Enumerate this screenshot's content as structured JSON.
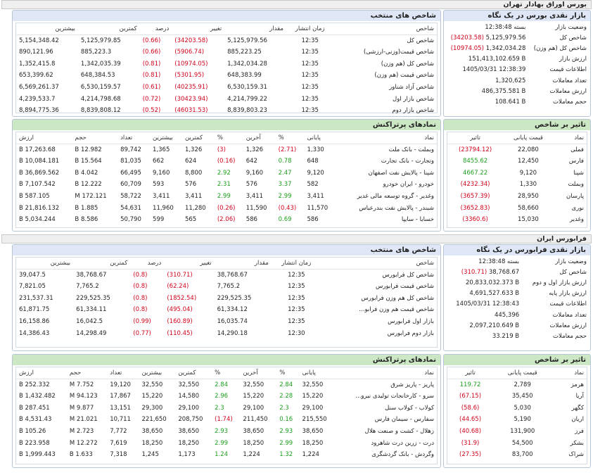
{
  "header": {
    "title": "بورس اوراق بهادار تهران"
  },
  "bourse": {
    "market_title": "بازار نقدی بورس در یک نگاه",
    "market": [
      {
        "label": "وضعیت بازار",
        "change": "",
        "value": "بسته 12:38:48"
      },
      {
        "label": "شاخص کل",
        "change": "(34203.58)",
        "value": "5,125,979.56"
      },
      {
        "label": "شاخص کل (هم وزن)",
        "change": "(10974.05)",
        "value": "1,342,034.28"
      },
      {
        "label": "ارزش بازار",
        "change": "",
        "value": "151,413,102.659 B"
      },
      {
        "label": "اطلاعات قیمت",
        "change": "",
        "value": "1405/03/31 12:38:39"
      },
      {
        "label": "تعداد معاملات",
        "change": "",
        "value": "1,320,625"
      },
      {
        "label": "ارزش معاملات",
        "change": "",
        "value": "486,375.581 B"
      },
      {
        "label": "حجم معاملات",
        "change": "",
        "value": "108.641 B"
      }
    ],
    "index_title": "شاخص های منتخب",
    "index_headers": [
      "شاخص",
      "زمان انتشار",
      "مقدار",
      "تغییر",
      "درصد",
      "کمترین",
      "بیشترین"
    ],
    "indices": [
      [
        "شاخص کل",
        "12:35",
        "5,125,979.56",
        "(34203.58)",
        "(0.66)",
        "5,125,979.85",
        "5,154,348.42"
      ],
      [
        "شاخص قیمت(وزنی-ارزشی)",
        "12:35",
        "885,223.25",
        "(5906.74)",
        "(0.66)",
        "885,223.3",
        "890,121.96"
      ],
      [
        "شاخص کل (هم وزن)",
        "12:35",
        "1,342,034.28",
        "(10974.05)",
        "(0.81)",
        "1,342,035.39",
        "1,352,415.8"
      ],
      [
        "شاخص قیمت (هم وزن)",
        "12:35",
        "648,383.99",
        "(5301.95)",
        "(0.81)",
        "648,384.53",
        "653,399.62"
      ],
      [
        "شاخص آزاد شناور",
        "12:35",
        "6,530,159.31",
        "(40235.91)",
        "(0.61)",
        "6,530,159.57",
        "6,569,261.37"
      ],
      [
        "شاخص بازار اول",
        "12:35",
        "4,214,799.22",
        "(30423.94)",
        "(0.72)",
        "4,214,798.68",
        "4,239,533.7"
      ],
      [
        "شاخص بازار دوم",
        "12:35",
        "8,839,803.23",
        "(46031.53)",
        "(0.52)",
        "8,839,808.12",
        "8,894,775.36"
      ]
    ],
    "impact_title": "تاثیر بر شاخص",
    "impact_headers": [
      "نماد",
      "قیمت پایانی",
      "تاثیر"
    ],
    "impact": [
      [
        "فملی",
        "22,080",
        "(23794.12)"
      ],
      [
        "فارس",
        "12,450",
        "8455.62"
      ],
      [
        "شپنا",
        "9,120",
        "4667.22"
      ],
      [
        "وبملت",
        "1,330",
        "(4232.34)"
      ],
      [
        "پارسان",
        "28,950",
        "(3657.39)"
      ],
      [
        "نوری",
        "58,660",
        "(3652.83)"
      ],
      [
        "وغدیر",
        "15,030",
        "(3360.6)"
      ]
    ],
    "trade_title": "نمادهای پرتراکنش",
    "trade_headers": [
      "نماد",
      "پایانی",
      "%",
      "آخرین",
      "%",
      "کمترین",
      "بیشترین",
      "تعداد",
      "حجم",
      "ارزش"
    ],
    "trades": [
      [
        "وبملت - بانک ملت",
        "1,330",
        "(2.71)",
        "1,326",
        "(3)",
        "1,326",
        "1,365",
        "89,742",
        "12.982 B",
        "17,263.68 B"
      ],
      [
        "وتجارت - بانک تجارت",
        "648",
        "0.78",
        "642",
        "(0.16)",
        "624",
        "662",
        "81,035",
        "15.564 B",
        "10,084.181 B"
      ],
      [
        "شپنا - پالایش نفت اصفهان",
        "9,120",
        "2.47",
        "9,160",
        "2.92",
        "8,800",
        "9,160",
        "66,495",
        "4.042 B",
        "36,869.562 B"
      ],
      [
        "خودرو - ایران خودرو",
        "582",
        "3.37",
        "576",
        "2.31",
        "576",
        "593",
        "60,709",
        "12.222 B",
        "7,107.542 B"
      ],
      [
        "وغدیر - گروه توسعه مالی غدیر",
        "3,411",
        "2.99",
        "3,411",
        "2.99",
        "3,411",
        "3,411",
        "58,722",
        "172.121 M",
        "587.105 B"
      ],
      [
        "شبندر - پالایش نفت بندرعباس",
        "11,570",
        "(0.43)",
        "11,590",
        "(0.26)",
        "11,280",
        "11,960",
        "54,631",
        "1.885 B",
        "21,816.132 B"
      ],
      [
        "خسایا - سایپا",
        "586",
        "0.69",
        "586",
        "(2.06)",
        "565",
        "599",
        "50,790",
        "8.586 B",
        "5,034.244 B"
      ]
    ]
  },
  "farabourse": {
    "header": "فرابورس ایران",
    "market_title": "بازار نقدی فرابورس در یک نگاه",
    "market": [
      {
        "label": "وضعیت بازار",
        "change": "",
        "value": "بسته 12:38:48"
      },
      {
        "label": "شاخص کل",
        "change": "(310.71)",
        "value": "38,768.67"
      },
      {
        "label": "ارزش بازار اول و دوم",
        "change": "",
        "value": "20,833,032.373 B"
      },
      {
        "label": "ارزش بازار پایه",
        "change": "",
        "value": "4,691,527.633 B"
      },
      {
        "label": "اطلاعات قیمت",
        "change": "",
        "value": "1405/03/31 12:38:43"
      },
      {
        "label": "تعداد معاملات",
        "change": "",
        "value": "445,396"
      },
      {
        "label": "ارزش معاملات",
        "change": "",
        "value": "2,097,210.649 B"
      },
      {
        "label": "حجم معاملات",
        "change": "",
        "value": "33.219 B"
      }
    ],
    "index_title": "شاخص های منتخب",
    "index_headers": [
      "شاخص",
      "زمان انتشار",
      "مقدار",
      "تغییر",
      "درصد",
      "کمترین",
      "بیشترین"
    ],
    "indices": [
      [
        "شاخص کل فرابورس",
        "12:35",
        "38,768.67",
        "(310.71)",
        "(0.8)",
        "38,768.67",
        "39,047.5"
      ],
      [
        "شاخص قیمت فرابورس",
        "12:35",
        "7,765.2",
        "(62.24)",
        "(0.8)",
        "7,765.2",
        "7,821.05"
      ],
      [
        "شاخص کل هم وزن فرابورس",
        "12:35",
        "229,525.35",
        "(1852.54)",
        "(0.8)",
        "229,525.35",
        "231,537.31"
      ],
      [
        "شاخص قیمت هم وزن فرابو...",
        "12:35",
        "61,334.12",
        "(495.04)",
        "(0.8)",
        "61,334.11",
        "61,871.75"
      ],
      [
        "بازار اول فرابورس",
        "12:35",
        "16,035.74",
        "(160.89)",
        "(0.99)",
        "16,042.5",
        "16,158.86"
      ],
      [
        "بازار دوم فرابورس",
        "12:30",
        "14,290.18",
        "(110.45)",
        "(0.77)",
        "14,298.49",
        "14,386.43"
      ]
    ],
    "impact_title": "تاثیر بر شاخص",
    "impact_headers": [
      "نماد",
      "قیمت پایانی",
      "تاثیر"
    ],
    "impact": [
      [
        "هرمز",
        "2,789",
        "119.72"
      ],
      [
        "آریا",
        "35,450",
        "(67.15)"
      ],
      [
        "کگهر",
        "5,030",
        "(58.6)"
      ],
      [
        "اریان",
        "5,190",
        "(44.65)"
      ],
      [
        "فرز",
        "131,900",
        "(40.68)"
      ],
      [
        "بشکر",
        "54,500",
        "(31.9)"
      ],
      [
        "شراک",
        "83,700",
        "(27.35)"
      ]
    ],
    "trade_title": "نمادهای پرتراکنش",
    "trade_headers": [
      "نماد",
      "پایانی",
      "%",
      "آخرین",
      "%",
      "کمترین",
      "بیشترین",
      "تعداد",
      "حجم",
      "ارزش"
    ],
    "trades": [
      [
        "پاریز - پاریز شرق",
        "32,550",
        "2.84",
        "32,550",
        "2.84",
        "32,550",
        "32,550",
        "19,120",
        "7.752 M",
        "252.332 B"
      ],
      [
        "سرو - کارخانجات تولیدی نیرو...",
        "15,220",
        "2.28",
        "15,220",
        "2.96",
        "14,580",
        "15,220",
        "17,867",
        "94.123 M",
        "1,432.482 B"
      ],
      [
        "کولاب - کولاب سنل",
        "29,100",
        "2.3",
        "29,100",
        "2.3",
        "29,100",
        "29,300",
        "13,151",
        "9.877 M",
        "287.451 B"
      ],
      [
        "سفارس - سیمان فارس",
        "215,550",
        "0.16",
        "211,450",
        "(1.74)",
        "208,750",
        "221,650",
        "10,711",
        "21.021 M",
        "4,531.43 B"
      ],
      [
        "زهلال - کشت و صنعت هلال",
        "38,650",
        "2.93",
        "38,650",
        "2.93",
        "38,650",
        "38,650",
        "7,772",
        "2.723 M",
        "105.26 B"
      ],
      [
        "درت - زرین درت شاهرود",
        "18,250",
        "2.99",
        "18,250",
        "2.99",
        "18,250",
        "18,250",
        "7,619",
        "12.272 M",
        "223.958 B"
      ],
      [
        "وگردش - بانک گردشگری",
        "1,224",
        "1.32",
        "1,224",
        "1.24",
        "1,173",
        "1,245",
        "7,318",
        "1.633 B",
        "1,999.443 B"
      ]
    ]
  }
}
